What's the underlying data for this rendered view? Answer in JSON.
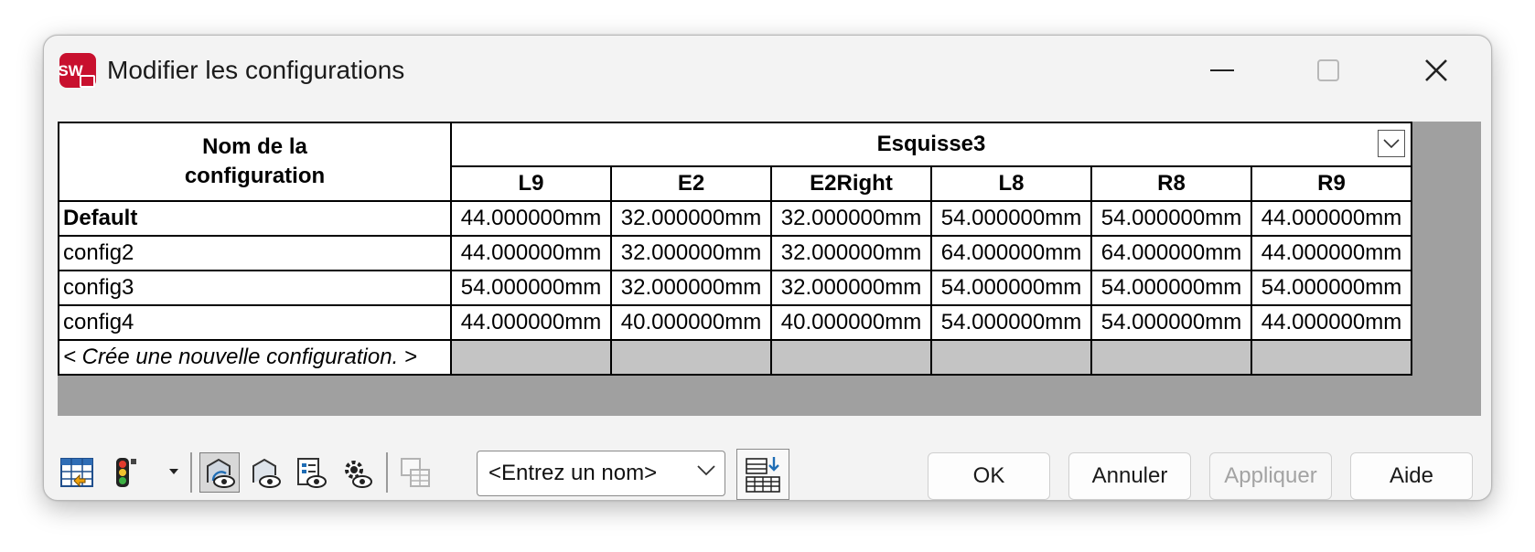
{
  "window": {
    "title": "Modifier les configurations",
    "app_icon": "solidworks-logo",
    "app_icon_letters": "SW"
  },
  "table": {
    "name_header_line1": "Nom de la",
    "name_header_line2": "configuration",
    "group_header": "Esquisse3",
    "columns": [
      "L9",
      "E2",
      "E2Right",
      "L8",
      "R8",
      "R9"
    ],
    "rows": [
      {
        "name": "Default",
        "values": [
          "44.000000mm",
          "32.000000mm",
          "32.000000mm",
          "54.000000mm",
          "54.000000mm",
          "44.000000mm"
        ]
      },
      {
        "name": "config2",
        "values": [
          "44.000000mm",
          "32.000000mm",
          "32.000000mm",
          "64.000000mm",
          "64.000000mm",
          "44.000000mm"
        ]
      },
      {
        "name": "config3",
        "values": [
          "54.000000mm",
          "32.000000mm",
          "32.000000mm",
          "54.000000mm",
          "54.000000mm",
          "54.000000mm"
        ]
      },
      {
        "name": "config4",
        "values": [
          "44.000000mm",
          "40.000000mm",
          "40.000000mm",
          "54.000000mm",
          "54.000000mm",
          "44.000000mm"
        ]
      }
    ],
    "new_row_label": "< Crée une nouvelle configuration. >"
  },
  "toolbar": {
    "icons": [
      "table-view-icon",
      "traffic-light-icon",
      "dropdown-caret-icon",
      "view-suppressed-icon",
      "view-icon",
      "view-list-icon",
      "settings-view-icon",
      "copy-table-icon"
    ],
    "view_name_placeholder": "<Entrez un nom>",
    "table_icon": "table-arrow-icon"
  },
  "buttons": {
    "ok": "OK",
    "cancel": "Annuler",
    "apply": "Appliquer",
    "help": "Aide"
  },
  "colors": {
    "grid_background": "#a0a0a0",
    "empty_cell": "#c4c4c4",
    "disabled_text": "#a3a3a3"
  }
}
